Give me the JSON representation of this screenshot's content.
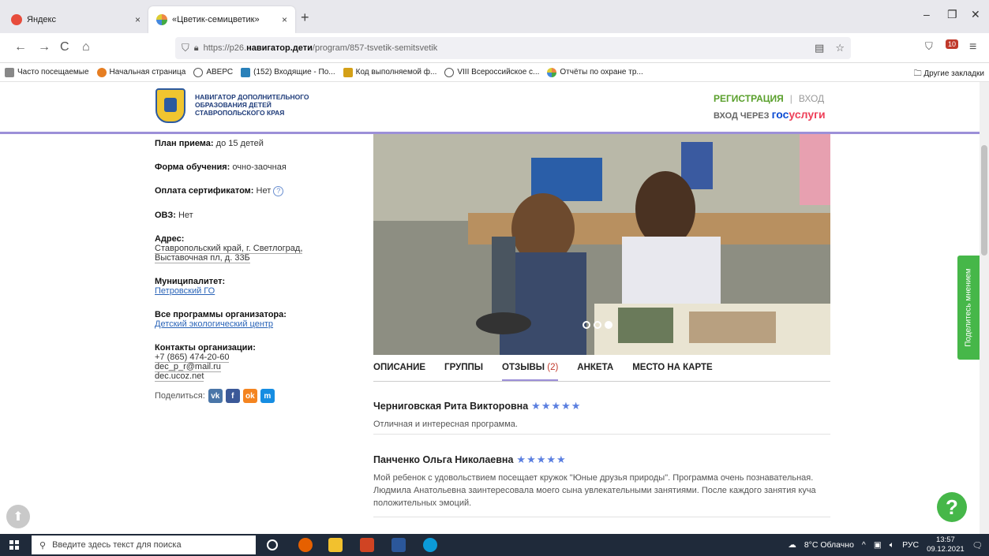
{
  "browser": {
    "tabs": [
      {
        "label": "Яндекс",
        "close": "×"
      },
      {
        "label": "«Цветик-семицветик»",
        "close": "×"
      }
    ],
    "new_tab": "+",
    "window": {
      "minimize": "–",
      "restore": "❐",
      "close": "✕"
    },
    "nav": {
      "back": "←",
      "forward": "→",
      "reload": "C",
      "home": "⌂"
    },
    "url": {
      "prefix": "https://p26.",
      "host": "навигатор.дети",
      "path": "/program/857-tsvetik-semitsvetik"
    },
    "bookmarks": [
      "Часто посещаемые",
      "Начальная страница",
      "АВЕРС",
      "(152) Входящие - По...",
      "Код выполняемой ф...",
      "VIII Всероссийское с...",
      "Отчёты по охране тр..."
    ],
    "other_bookmarks": "Другие закладки",
    "badge": "10"
  },
  "header": {
    "logo_lines": [
      "НАВИГАТОР ДОПОЛНИТЕЛЬНОГО",
      "ОБРАЗОВАНИЯ ДЕТЕЙ",
      "СТАВРОПОЛЬСКОГО КРАЯ"
    ],
    "register": "РЕГИСТРАЦИЯ",
    "separator": "|",
    "login": "ВХОД",
    "via": "ВХОД ЧЕРЕЗ",
    "gos_a": "гос",
    "gos_b": "услуги"
  },
  "info": {
    "plan_label": "План приема:",
    "plan_value": "до 15 детей",
    "form_label": "Форма обучения:",
    "form_value": "очно-заочная",
    "pay_label": "Оплата сертификатом:",
    "pay_value": "Нет",
    "help": "?",
    "ovz_label": "ОВЗ:",
    "ovz_value": "Нет",
    "address_label": "Адрес:",
    "address_line1": "Ставропольский край, г. Светлоград,",
    "address_line2": "Выставочная пл, д. 33Б",
    "muni_label": "Муниципалитет:",
    "muni_value": "Петровский ГО",
    "programs_label": "Все программы организатора:",
    "programs_value": "Детский экологический центр",
    "contacts_label": "Контакты организации:",
    "phone": "+7 (865) 474-20-60",
    "email": "dec_p_r@mail.ru",
    "site": "dec.ucoz.net",
    "share_label": "Поделиться:",
    "share_buttons": [
      "vk",
      "f",
      "ok",
      "m"
    ]
  },
  "tabs": [
    {
      "label": "ОПИСАНИЕ",
      "count": ""
    },
    {
      "label": "ГРУППЫ",
      "count": ""
    },
    {
      "label": "ОТЗЫВЫ",
      "count": "(2)"
    },
    {
      "label": "АНКЕТА",
      "count": ""
    },
    {
      "label": "МЕСТО НА КАРТЕ",
      "count": ""
    }
  ],
  "reviews": [
    {
      "name": "Черниговская Рита Викторовна",
      "stars": "★★★★★",
      "rating": 5,
      "text": "Отличная и интересная программа."
    },
    {
      "name": "Панченко Ольга Николаевна",
      "stars": "★★★★★",
      "rating": 5,
      "text": "Мой ребенок с удовольствием посещает кружок \"Юные друзья природы\". Программа очень познавательная. Людмила Анатольевна заинтересовала моего сына увлекательными занятиями. После каждого занятия куча положительных эмоций."
    }
  ],
  "feedback": "Поделитесь мнением",
  "help_button": "?",
  "up_button": "⬆",
  "taskbar": {
    "search_placeholder": "Введите здесь текст для поиска",
    "weather": "8°C  Облачно",
    "lang": "РУС",
    "time": "13:57",
    "date": "09.12.2021"
  },
  "colors": {
    "accent": "#9c8fd8",
    "green": "#46b749",
    "link": "#2a64b8",
    "star": "#5b7fe0"
  }
}
